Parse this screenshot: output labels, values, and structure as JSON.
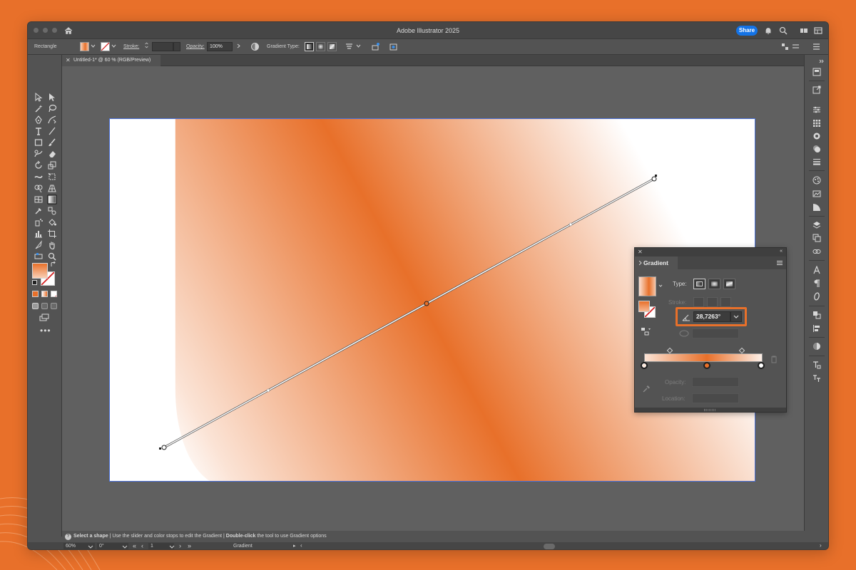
{
  "window": {
    "title": "Adobe Illustrator 2025",
    "share_label": "Share"
  },
  "control_bar": {
    "selection_type": "Rectangle",
    "stroke_label": "Stroke:",
    "opacity_label": "Opacity:",
    "opacity_value": "100%",
    "gradient_type_label": "Gradient Type:"
  },
  "document_tab": {
    "close": "✕",
    "title": "Untitled-1* @ 60 % (RGB/Preview)"
  },
  "gradient_panel": {
    "title": "Gradient",
    "close": "✕",
    "collapse": "«",
    "type_label": "Type:",
    "stroke_label": "Stroke:",
    "angle_value": "28,7263°",
    "opacity_label": "Opacity:",
    "location_label": "Location:",
    "stops": [
      {
        "location": 0,
        "color": "#fbe3d5"
      },
      {
        "location": 53,
        "color": "#e8702a"
      },
      {
        "location": 100,
        "color": "#ffffff"
      }
    ]
  },
  "hint_bar": {
    "icon": "?",
    "part1_bold": "Select a shape",
    "part2": "Use the slider and color stops to edit the Gradient",
    "part3_bold": "Double-click",
    "part4": "the tool to use Gradient options"
  },
  "status_bar": {
    "zoom": "60%",
    "rotation": "0°",
    "artboard": "1",
    "tool_name": "Gradient"
  },
  "colors": {
    "accent_orange": "#e8702a",
    "share_blue": "#1473e6",
    "ui_dark": "#535353",
    "selection_blue": "#4a6fd6"
  }
}
